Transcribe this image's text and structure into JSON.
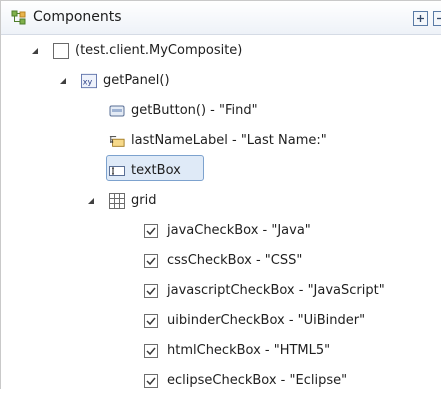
{
  "view": {
    "title": "Components",
    "toolbar": {
      "expand_all_icon": "expand-all-icon",
      "collapse_all_icon": "collapse-all-icon"
    }
  },
  "tree": {
    "root": {
      "label": "(test.client.MyComposite)",
      "icon": "composite-icon",
      "expanded": true
    },
    "panel": {
      "label": "getPanel()",
      "icon": "xy-panel-icon",
      "expanded": true
    },
    "button": {
      "label": "getButton() - \"Find\"",
      "icon": "button-icon"
    },
    "last_name_label": {
      "label": "lastNameLabel - \"Last Name:\"",
      "icon": "label-icon"
    },
    "text_box": {
      "label": "textBox",
      "icon": "textbox-icon",
      "selected": true
    },
    "grid": {
      "label": "grid",
      "icon": "grid-icon",
      "expanded": true
    },
    "checkboxes": [
      {
        "label": "javaCheckBox - \"Java\"",
        "checked": true
      },
      {
        "label": "cssCheckBox - \"CSS\"",
        "checked": true
      },
      {
        "label": "javascriptCheckBox - \"JavaScript\"",
        "checked": true
      },
      {
        "label": "uibinderCheckBox - \"UiBinder\"",
        "checked": true
      },
      {
        "label": "htmlCheckBox - \"HTML5\"",
        "checked": true
      },
      {
        "label": "eclipseCheckBox - \"Eclipse\"",
        "checked": true
      }
    ]
  }
}
